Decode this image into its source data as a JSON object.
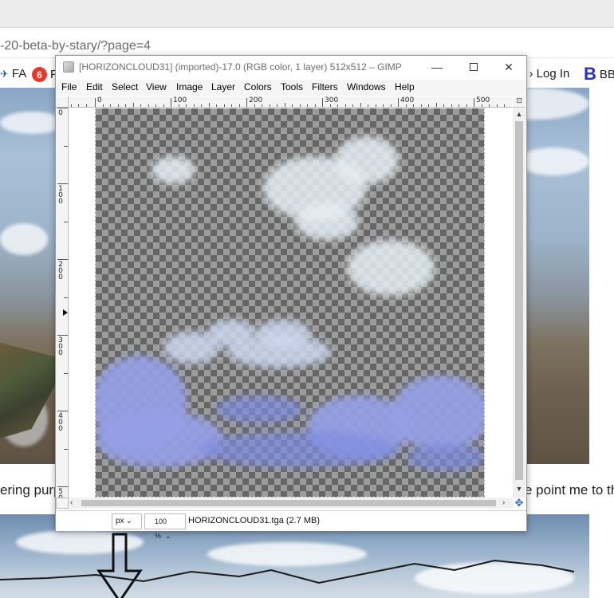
{
  "browser": {
    "url": "-20-beta-by-stary/?page=4",
    "bookmarks": [
      {
        "label": "FA",
        "icon": "paper-plane-icon"
      },
      {
        "label": "F",
        "icon": "red-6-icon"
      },
      {
        "label": "e › Log In",
        "icon": ""
      },
      {
        "label": "BB",
        "icon": "b-logo-icon"
      }
    ]
  },
  "page": {
    "text_left": "ering purp",
    "text_right": "e point me to th",
    "arrow_icon": "down-arrow-icon"
  },
  "gimp": {
    "title": "[HORIZONCLOUD31] (imported)-17.0 (RGB color, 1 layer) 512x512 – GIMP",
    "window_buttons": {
      "minimize": "—",
      "maximize": "",
      "close": "✕"
    },
    "menu": [
      "File",
      "Edit",
      "Select",
      "View",
      "Image",
      "Layer",
      "Colors",
      "Tools",
      "Filters",
      "Windows",
      "Help"
    ],
    "ruler_h_labels": [
      "0",
      "100",
      "200",
      "300",
      "400",
      "500"
    ],
    "ruler_v_labels": [
      "0",
      "1\n0\n0",
      "2\n0\n0",
      "3\n0\n0",
      "4\n0\n0",
      "5\n0"
    ],
    "status": {
      "unit": "px",
      "zoom": "100 %",
      "file_info": "HORIZONCLOUD31.tga (2.7 MB)"
    },
    "accent_color": "#2a66c8",
    "checker_dark": "#666666",
    "checker_light": "#9c9c9c",
    "cloud_color": "#8e9be6"
  }
}
